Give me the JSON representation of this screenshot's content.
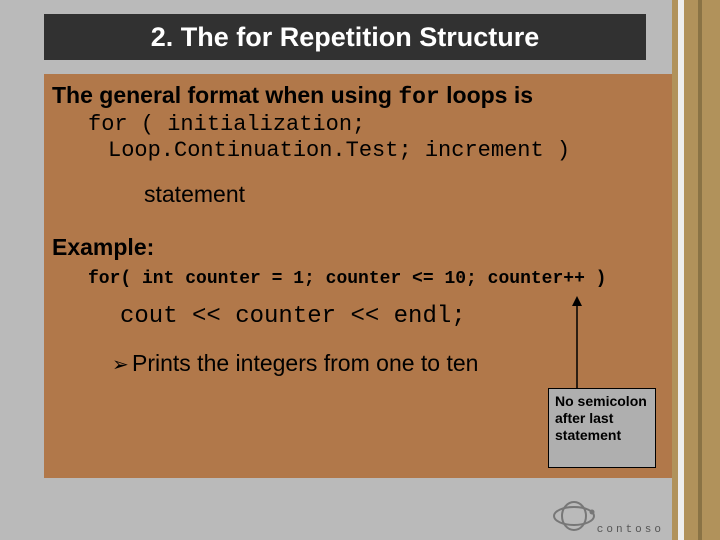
{
  "title": "2.   The for Repetition Structure",
  "intro_before": "The general format when using ",
  "intro_mono": "for",
  "intro_after": " loops is",
  "code_line1": "for ( initialization;",
  "code_line2": "Loop.Continuation.Test; increment )",
  "statement_line": "statement",
  "example_label": "Example:",
  "example_code": "for( int counter = 1; counter <= 10; counter++ )",
  "example_body": "cout << counter << endl;",
  "bullet_glyph": "➢",
  "bullet_text": "Prints the integers from one to ten",
  "note_text": "No semicolon after last statement",
  "logo_text": "contoso"
}
